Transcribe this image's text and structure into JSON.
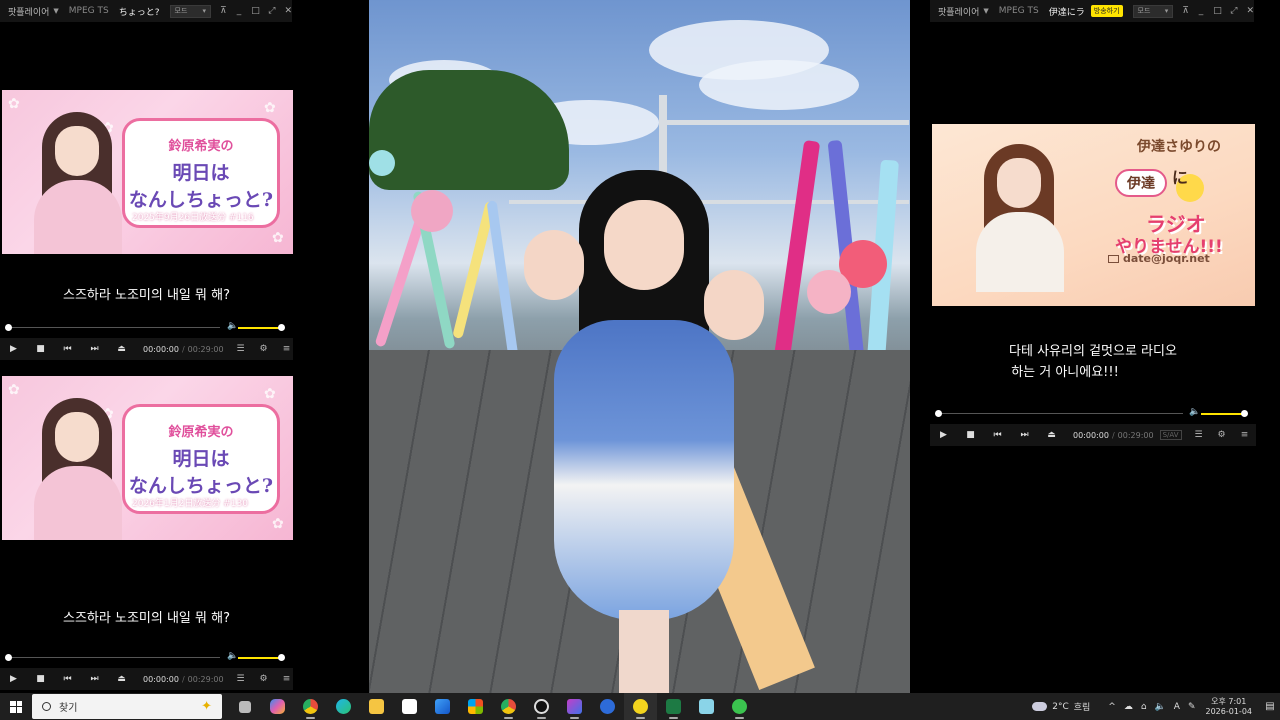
{
  "players": {
    "top_left": {
      "app": "팟플레이어",
      "format": "MPEG TS",
      "title": "ちょっと?",
      "mode": "모드",
      "controls": [
        "⊼",
        "_",
        "□",
        "⤢",
        "✕"
      ],
      "thumb": {
        "program_line1": "鈴原希実の",
        "program_line2": "明日は",
        "program_line3": "なんしちょっと?",
        "episode": "2025年9月26日放送分 #116"
      },
      "caption": "스즈하라 노조미의 내일 뭐 해?",
      "time": "00:00:00",
      "duration": "00:29:00",
      "seek_progress": 0.0,
      "volume_level": 1.0
    },
    "bottom_left": {
      "thumb": {
        "program_line1": "鈴原希実の",
        "program_line2": "明日は",
        "program_line3": "なんしちょっと?",
        "episode": "2026年1月2日放送分 #130"
      },
      "caption": "스즈하라 노조미의 내일 뭐 해?",
      "time": "00:00:00",
      "duration": "00:29:00",
      "seek_progress": 0.0,
      "volume_level": 1.0
    },
    "right": {
      "app": "팟플레이어",
      "format": "MPEG TS",
      "title": "伊達にラ",
      "badge": "방송하기",
      "mode": "모드",
      "controls": [
        "⊼",
        "_",
        "□",
        "⤢",
        "✕"
      ],
      "thumb": {
        "host": "伊達さゆりの",
        "date": "伊達",
        "ni": "に",
        "title1": "ラジオ",
        "title2": "やりません!!!",
        "mail": "date@joqr.net"
      },
      "caption_line1": "다테 사유리의 겉멋으로 라디오",
      "caption_line2": "하는 거 아니에요!!!",
      "time": "00:00:00",
      "duration": "00:29:00",
      "sav": "S/AV",
      "seek_progress": 0.0,
      "volume_level": 1.0
    }
  },
  "player_buttons": [
    "▶",
    "■",
    "⏮",
    "⏭",
    "⏏"
  ],
  "player_right_buttons": [
    "☰",
    "⚙",
    "≡"
  ],
  "taskbar": {
    "search_placeholder": "찾기",
    "apps": [
      "widgets",
      "copilot",
      "chrome",
      "edge",
      "file-explorer",
      "store",
      "media-player",
      "paint",
      "obs",
      "clipchamp",
      "photos",
      "globe",
      "notes",
      "excel",
      "mail",
      "line"
    ],
    "weather_temp": "2°C",
    "weather_text": "흐림",
    "tray_up": "^",
    "tray_lang": "A",
    "time": "오후 7:01",
    "date": "2026-01-04"
  },
  "colors": {
    "accent_yellow": "#ffe400",
    "player_bar": "#141414"
  }
}
